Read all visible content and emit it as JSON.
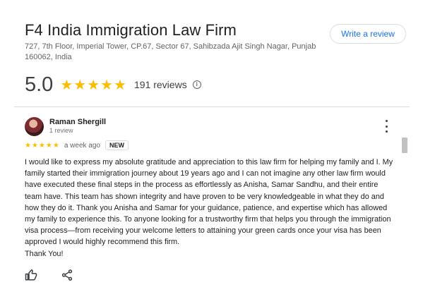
{
  "business": {
    "name": "F4 India Immigration Law Firm",
    "address": "727, 7th Floor, Imperial Tower, CP.67, Sector 67, Sahibzada Ajit Singh Nagar, Punjab 160062, India",
    "write_review_label": "Write a review",
    "rating": "5.0",
    "stars": "★★★★★",
    "review_count": "191 reviews",
    "info_icon": "i"
  },
  "review": {
    "author": "Raman Shergill",
    "author_meta": "1 review",
    "stars": "★★★★★",
    "time": "a week ago",
    "badge": "NEW",
    "text": "I would like to express my absolute gratitude and appreciation to this law firm for helping my family and I. My family started their immigration journey about 19 years ago and I can not imagine any other law firm would have executed these final steps in the process as effortlessly as Anisha, Samar Sandhu, and their entire team have. This team has shown integrity and have proven to be very knowledgeable in what they do and how they do it. Thank you Anisha and Samar for your guidance, patience, and expertise which has allowed my family to experience this. To anyone looking for a trustworthy firm that helps you through the immigration visa process—from receiving your welcome letters to attaining your green cards once your visa has been approved I would highly recommend this firm.",
    "closing": "Thank You!"
  },
  "icons": {
    "like": "thumbs-up-icon",
    "share": "share-icon",
    "menu": "more-vert-icon",
    "info": "info-icon"
  },
  "colors": {
    "star": "#fbbc04",
    "link_blue": "#1a73e8",
    "text": "#202124",
    "muted": "#5f6368"
  }
}
